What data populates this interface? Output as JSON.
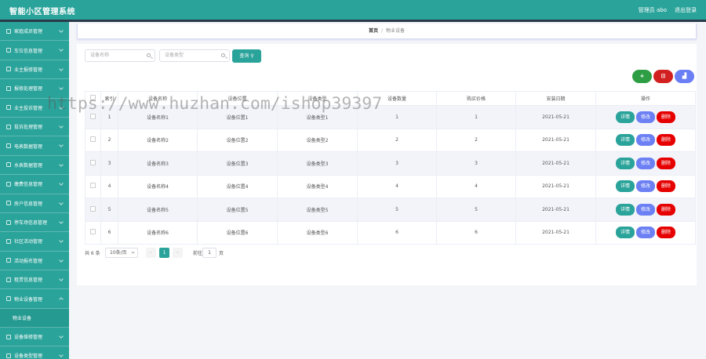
{
  "app": {
    "title": "智能小区管理系统",
    "user": "管理员 abo",
    "logout": "退出登录"
  },
  "sidebar": {
    "items": [
      {
        "label": "家庭成员管理"
      },
      {
        "label": "车位信息管理"
      },
      {
        "label": "业主报修管理"
      },
      {
        "label": "报修处理管理"
      },
      {
        "label": "业主投诉管理"
      },
      {
        "label": "投诉处理管理"
      },
      {
        "label": "电表数据管理"
      },
      {
        "label": "水表数据管理"
      },
      {
        "label": "缴费信息管理"
      },
      {
        "label": "房户信息管理"
      },
      {
        "label": "停车场信息管理"
      },
      {
        "label": "社区活动管理"
      },
      {
        "label": "活动报名管理"
      },
      {
        "label": "租赁信息管理"
      },
      {
        "label": "物业设备管理"
      }
    ],
    "sub_item": "物业设备",
    "after_items": [
      {
        "label": "设备维修管理"
      },
      {
        "label": "设备类型管理"
      }
    ]
  },
  "breadcrumb": {
    "home": "首页",
    "separator": "/",
    "current": "物业设备"
  },
  "search": {
    "name_placeholder": "设备名称",
    "type_placeholder": "设备类型",
    "button": "查询"
  },
  "actions": {
    "add": "+",
    "delete": "⊡",
    "chart": "▟"
  },
  "colors": {
    "accent": "#2aa39a",
    "add": "#2e9e44",
    "delete": "#d21f1f",
    "chart": "#6a7ef6",
    "edit": "#6c80f4"
  },
  "table": {
    "headers": [
      "",
      "索引",
      "设备名称",
      "设备位置",
      "设备类型",
      "设备数量",
      "购买价格",
      "安装日期",
      "操作"
    ],
    "rows": [
      {
        "index": "1",
        "name": "设备名称1",
        "location": "设备位置1",
        "type": "设备类型1",
        "quantity": "1",
        "price": "1",
        "date": "2021-05-21"
      },
      {
        "index": "2",
        "name": "设备名称2",
        "location": "设备位置2",
        "type": "设备类型2",
        "quantity": "2",
        "price": "2",
        "date": "2021-05-21"
      },
      {
        "index": "3",
        "name": "设备名称3",
        "location": "设备位置3",
        "type": "设备类型3",
        "quantity": "3",
        "price": "3",
        "date": "2021-05-21"
      },
      {
        "index": "4",
        "name": "设备名称4",
        "location": "设备位置4",
        "type": "设备类型4",
        "quantity": "4",
        "price": "4",
        "date": "2021-05-21"
      },
      {
        "index": "5",
        "name": "设备名称5",
        "location": "设备位置5",
        "type": "设备类型5",
        "quantity": "5",
        "price": "5",
        "date": "2021-05-21"
      },
      {
        "index": "6",
        "name": "设备名称6",
        "location": "设备位置6",
        "type": "设备类型6",
        "quantity": "6",
        "price": "6",
        "date": "2021-05-21"
      }
    ],
    "row_buttons": {
      "detail": "详情",
      "edit": "修改",
      "delete": "删除"
    }
  },
  "pagination": {
    "total": "共 6 条",
    "page_size": "10条/页",
    "prev": "‹",
    "current": "1",
    "next": "›",
    "goto_label": "前往",
    "goto_value": "1",
    "page_label": "页"
  },
  "watermark": "https://www.huzhan.com/ishop39397"
}
